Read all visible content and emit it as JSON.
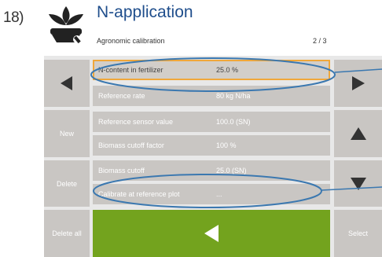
{
  "step_label": "18)",
  "header": {
    "title": "N-application",
    "subtitle": "Agronomic calibration",
    "page": "2 / 3"
  },
  "left_buttons": {
    "new": "New",
    "delete": "Delete",
    "delete_all": "Delete all"
  },
  "right_buttons": {
    "select": "Select"
  },
  "rows": [
    {
      "label": "N-content in fertilizer",
      "value": "25.0 %"
    },
    {
      "label": "Reference rate",
      "value": "80 kg N/ha"
    },
    {
      "label": "Reference sensor value",
      "value": "100.0 (SN)"
    },
    {
      "label": "Biomass cutoff factor",
      "value": "100 %"
    },
    {
      "label": "Biomass cutoff",
      "value": "25.0 (SN)"
    },
    {
      "label": "Calibrate at reference plot",
      "value": "..."
    }
  ],
  "colors": {
    "title": "#1f4e8c",
    "button_gray": "#c9c6c3",
    "selected_border": "#f0a73a",
    "confirm_green": "#73a31e",
    "annotation_blue": "#3b78b0"
  },
  "icons": {
    "logo": "plant-wrench-icon",
    "left_nav": "arrow-left-icon",
    "right_nav": "arrow-right-icon",
    "up": "arrow-up-icon",
    "down": "arrow-down-icon",
    "confirm": "arrow-left-icon"
  }
}
